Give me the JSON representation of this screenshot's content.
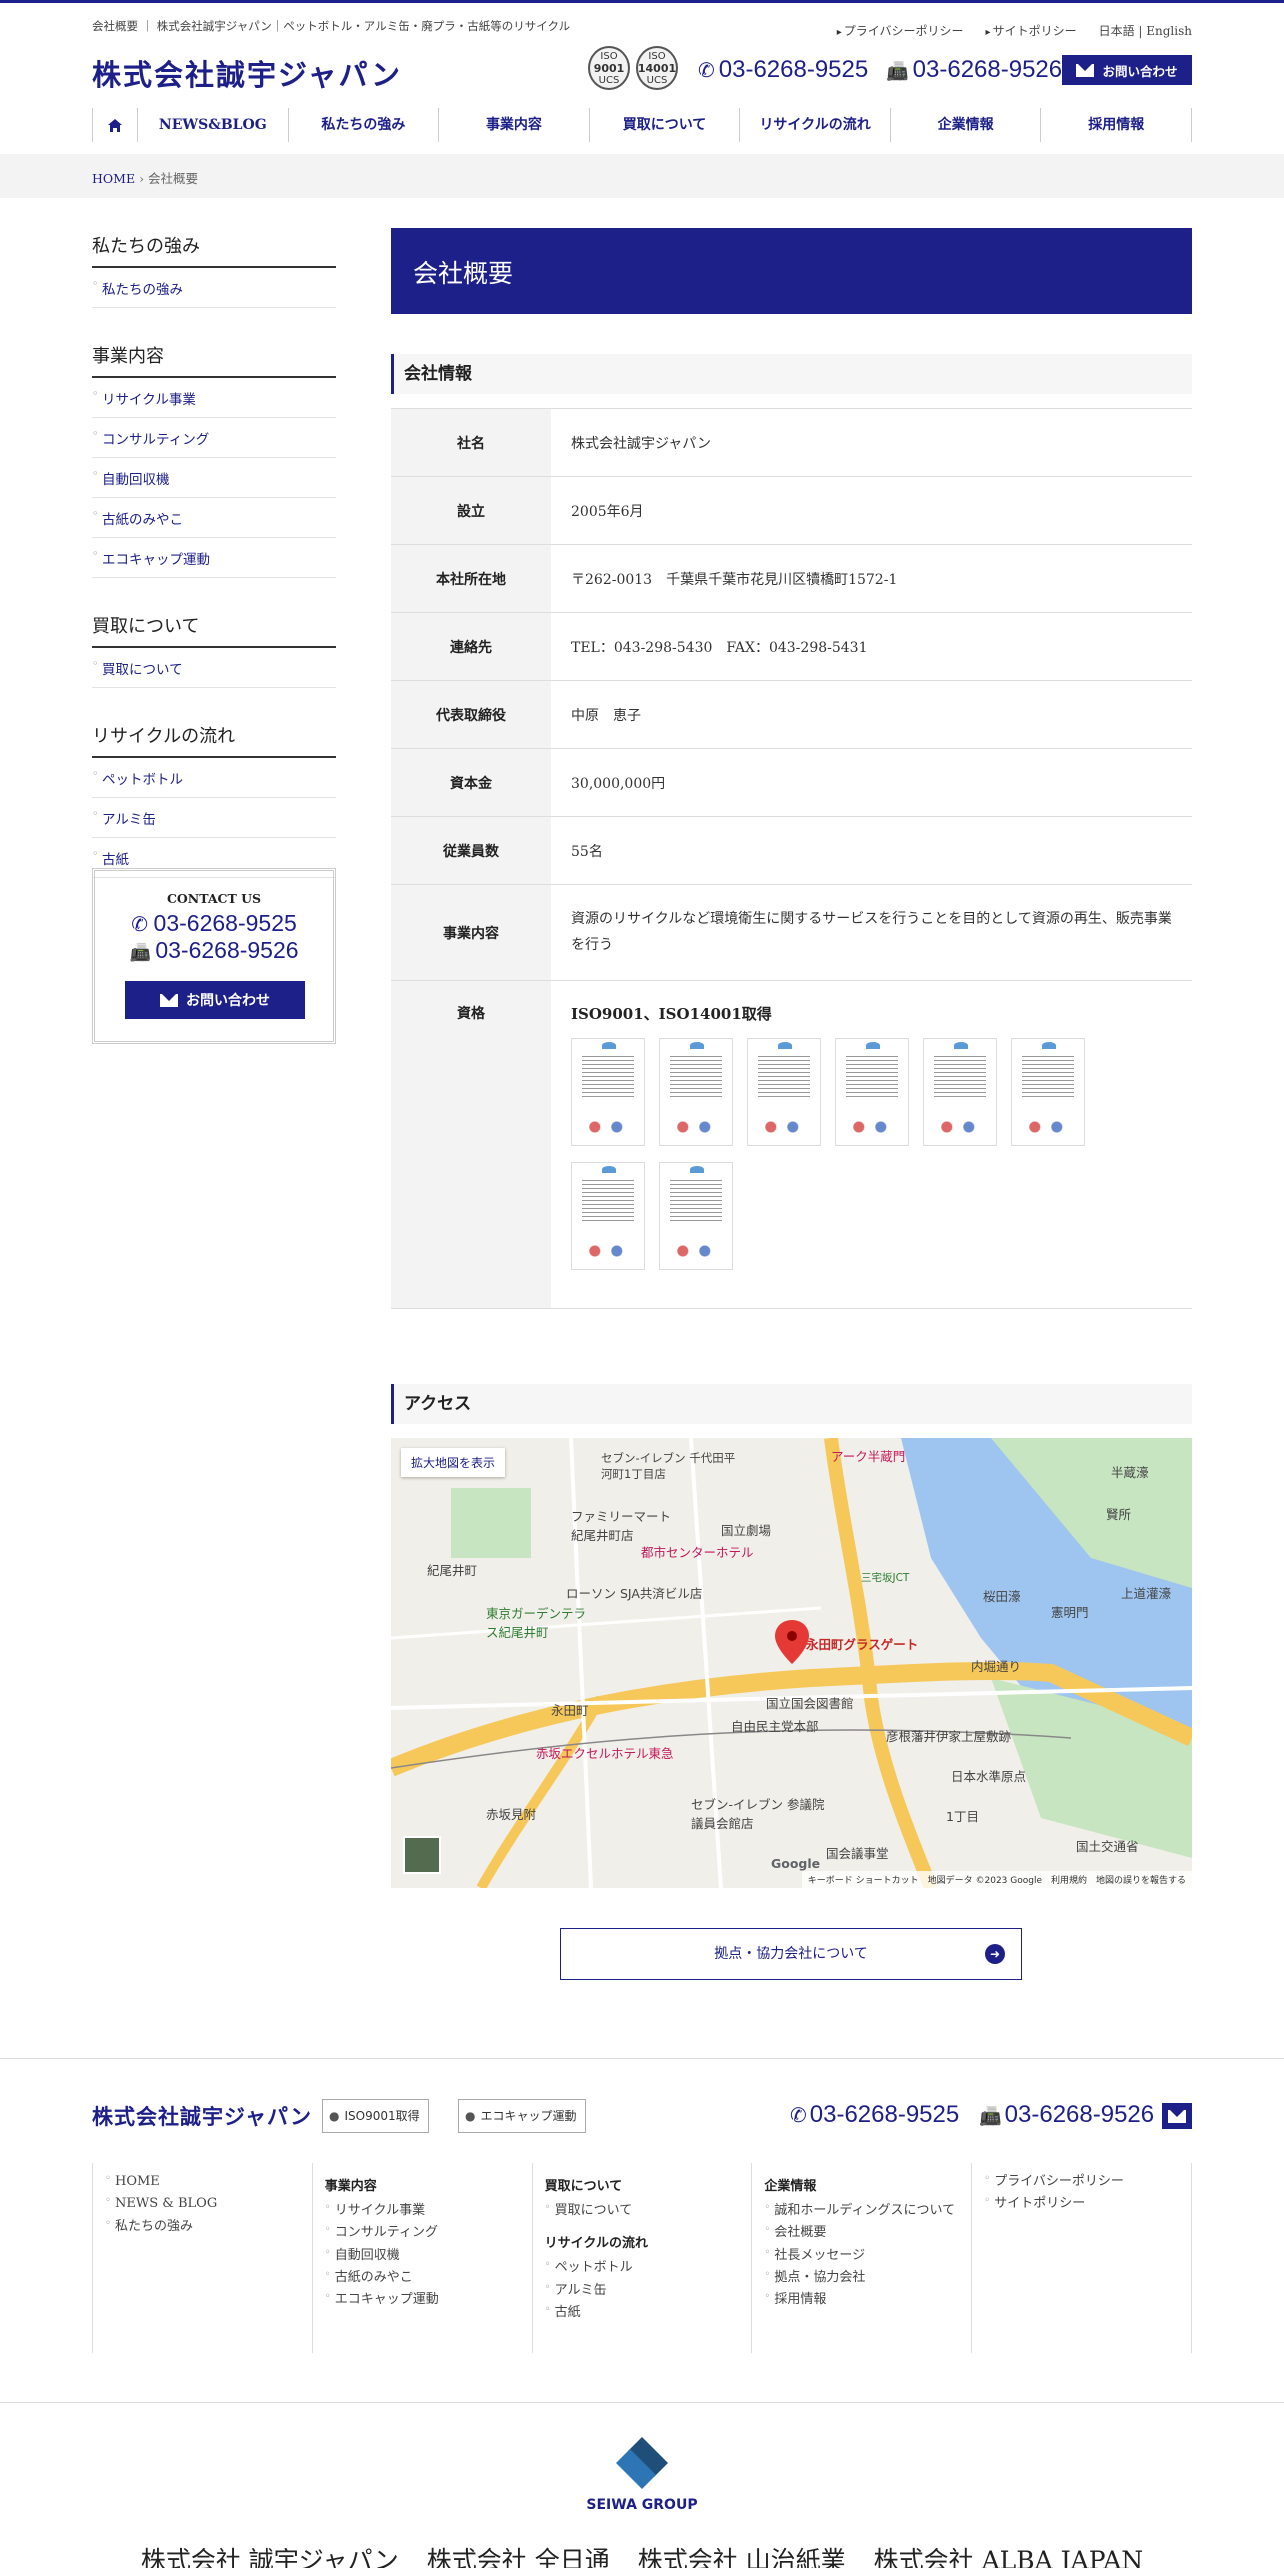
{
  "header": {
    "tagline": "会社概要 ｜ 株式会社誠宇ジャパン｜ペットボトル・アルミ缶・廃プラ・古紙等のリサイクル",
    "links": [
      "プライバシーポリシー",
      "サイトポリシー"
    ],
    "lang": "日本語 | English",
    "logo": "株式会社誠宇ジャパン",
    "iso_badges": [
      {
        "top": "ISO",
        "num": "9001",
        "org": "UCS"
      },
      {
        "top": "ISO",
        "num": "14001",
        "org": "UCS"
      }
    ],
    "tel": "03-6268-9525",
    "fax": "03-6268-9526",
    "contact_label": "お問い合わせ"
  },
  "nav": [
    "NEWS&BLOG",
    "私たちの強み",
    "事業内容",
    "買取について",
    "リサイクルの流れ",
    "企業情報",
    "採用情報"
  ],
  "breadcrumb": {
    "home": "HOME",
    "sep": "›",
    "current": "会社概要"
  },
  "sidebar": [
    {
      "title": "私たちの強み",
      "items": [
        "私たちの強み"
      ]
    },
    {
      "title": "事業内容",
      "items": [
        "リサイクル事業",
        "コンサルティング",
        "自動回収機",
        "古紙のみやこ",
        "エコキャップ運動"
      ]
    },
    {
      "title": "買取について",
      "items": [
        "買取について"
      ]
    },
    {
      "title": "リサイクルの流れ",
      "items": [
        "ペットボトル",
        "アルミ缶",
        "古紙"
      ]
    }
  ],
  "contact_box": {
    "title": "CONTACT US",
    "tel": "03-6268-9525",
    "fax": "03-6268-9526",
    "button": "お問い合わせ"
  },
  "main": {
    "title": "会社概要",
    "company_heading": "会社情報",
    "rows": [
      {
        "label": "社名",
        "value": "株式会社誠宇ジャパン"
      },
      {
        "label": "設立",
        "value": "2005年6月"
      },
      {
        "label": "本社所在地",
        "value": "〒262-0013　千葉県千葉市花見川区犢橋町1572-1"
      },
      {
        "label": "連絡先",
        "value": "TEL：043-298-5430　FAX：043-298-5431"
      },
      {
        "label": "代表取締役",
        "value": "中原　恵子"
      },
      {
        "label": "資本金",
        "value": "30,000,000円"
      },
      {
        "label": "従業員数",
        "value": "55名"
      },
      {
        "label": "事業内容",
        "value": "資源のリサイクルなど環境衛生に関するサービスを行うことを目的として資源の再生、販売事業を行う"
      }
    ],
    "cert_label": "資格",
    "cert_title": "ISO9001、ISO14001取得",
    "cert_count": 8,
    "access_heading": "アクセス",
    "map": {
      "expand": "拡大地図を表示",
      "marker": "永田町グラスゲート",
      "labels": [
        "紀尾井町",
        "セブン-イレブン 千代田平河町1丁目店",
        "ファミリーマート紀尾井町店",
        "都市センターホテル",
        "国立劇場",
        "ローソン SJA共済ビル店",
        "東京ガーデンテラス紀尾井町",
        "永田町",
        "国立国会図書館",
        "自由民主党本部",
        "内堀通り",
        "桜田濠",
        "三宅坂JCT",
        "彦根藩井伊家上屋敷跡",
        "日本水準原点",
        "赤坂エクセルホテル東急",
        "赤坂見附",
        "セブン-イレブン 参議院議員会館店",
        "1丁目",
        "国会議事堂",
        "国土交通省",
        "半蔵濠",
        "上道灌濠",
        "賢所",
        "憲明門",
        "アーク半蔵門"
      ],
      "attribution": "キーボード ショートカット　地図データ ©2023 Google　利用規約　地図の誤りを報告する",
      "google": "Google"
    },
    "partners_button": "拠点・協力会社について"
  },
  "footer": {
    "logo": "株式会社誠宇ジャパン",
    "badges": [
      "ISO9001取得",
      "エコキャップ運動"
    ],
    "tel": "03-6268-9525",
    "fax": "03-6268-9526",
    "cols": [
      {
        "groups": [
          {
            "heading": "",
            "items": [
              "HOME",
              "NEWS & BLOG",
              "私たちの強み"
            ]
          }
        ]
      },
      {
        "groups": [
          {
            "heading": "事業内容",
            "items": [
              "リサイクル事業",
              "コンサルティング",
              "自動回収機",
              "古紙のみやこ",
              "エコキャップ運動"
            ]
          }
        ]
      },
      {
        "groups": [
          {
            "heading": "買取について",
            "items": [
              "買取について"
            ]
          },
          {
            "heading": "リサイクルの流れ",
            "items": [
              "ペットボトル",
              "アルミ缶",
              "古紙"
            ]
          }
        ]
      },
      {
        "groups": [
          {
            "heading": "企業情報",
            "items": [
              "誠和ホールディングスについて",
              "会社概要",
              "社長メッセージ",
              "拠点・協力会社",
              "採用情報"
            ]
          }
        ]
      },
      {
        "groups": [
          {
            "heading": "",
            "items": [
              "プライバシーポリシー",
              "サイトポリシー"
            ]
          }
        ]
      }
    ]
  },
  "group": {
    "name": "SEIWA GROUP",
    "companies": [
      "株式会社 誠宇ジャパン",
      "株式会社 全日通",
      "株式会社 山治紙業",
      "株式会社 ALBA JAPAN"
    ]
  },
  "colors": {
    "brand": "#1d2088",
    "map_water": "#9ec5f0",
    "map_road": "#f6c85a",
    "map_park": "#c7e5c0"
  }
}
